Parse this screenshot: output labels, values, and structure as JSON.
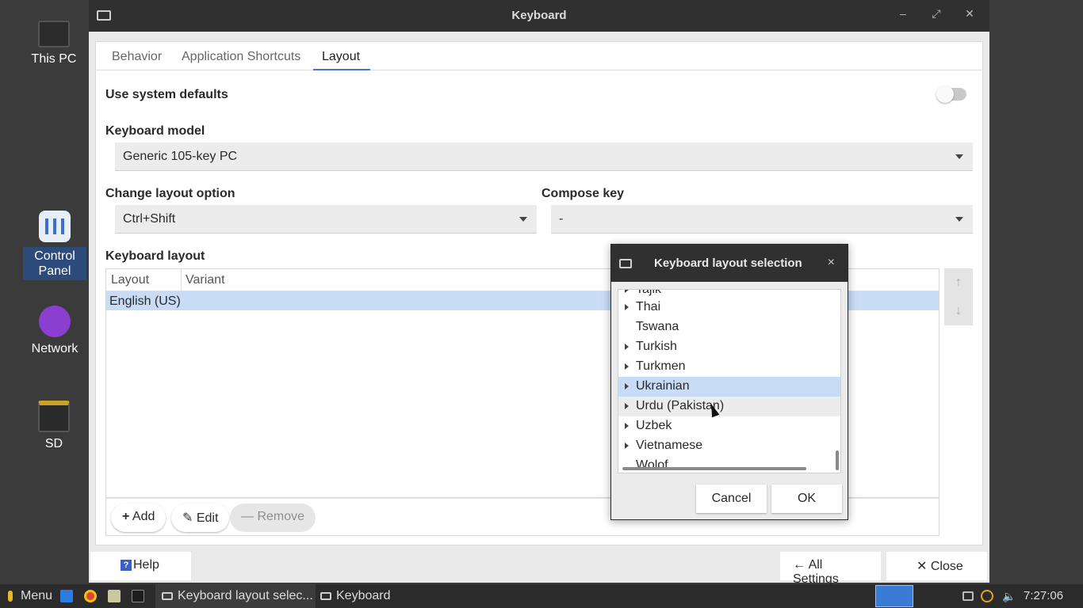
{
  "desktop": {
    "icons": [
      {
        "label": "This PC"
      },
      {
        "label": "Control\nPanel"
      },
      {
        "label": "Network"
      },
      {
        "label": "SD"
      }
    ]
  },
  "window": {
    "title": "Keyboard",
    "controls": {
      "minimize": "–",
      "maximize": "⤢",
      "close": "✕"
    },
    "tabs": [
      "Behavior",
      "Application Shortcuts",
      "Layout"
    ],
    "active_tab": "Layout",
    "use_system_defaults": {
      "label": "Use system defaults",
      "enabled": false
    },
    "keyboard_model": {
      "label": "Keyboard model",
      "value": "Generic 105-key PC"
    },
    "change_layout_option": {
      "label": "Change layout option",
      "value": "Ctrl+Shift"
    },
    "compose_key": {
      "label": "Compose key",
      "value": "-"
    },
    "keyboard_layout": {
      "label": "Keyboard layout",
      "columns": [
        "Layout",
        "Variant"
      ],
      "rows": [
        {
          "layout": "English (US)",
          "variant": ""
        }
      ]
    },
    "move_up_label": "↑",
    "move_down_label": "↓",
    "buttons": {
      "add": "Add",
      "edit": "Edit",
      "remove": "Remove"
    },
    "help": "Help",
    "all_settings": "All Settings",
    "close": "Close"
  },
  "dialog": {
    "title": "Keyboard layout selection",
    "close": "×",
    "items": [
      {
        "label": "Tajik",
        "expandable": true
      },
      {
        "label": "Thai",
        "expandable": true
      },
      {
        "label": "Tswana",
        "expandable": false
      },
      {
        "label": "Turkish",
        "expandable": true
      },
      {
        "label": "Turkmen",
        "expandable": true
      },
      {
        "label": "Ukrainian",
        "expandable": true,
        "selected": true
      },
      {
        "label": "Urdu (Pakistan)",
        "expandable": true,
        "hover": true
      },
      {
        "label": "Uzbek",
        "expandable": true
      },
      {
        "label": "Vietnamese",
        "expandable": true
      },
      {
        "label": "Wolof",
        "expandable": false
      }
    ],
    "cancel": "Cancel",
    "ok": "OK"
  },
  "taskbar": {
    "menu": "Menu",
    "tasks": [
      {
        "label": "Keyboard layout selec...",
        "active": true
      },
      {
        "label": "Keyboard",
        "active": false
      }
    ],
    "clock": "7:27:06 am"
  }
}
